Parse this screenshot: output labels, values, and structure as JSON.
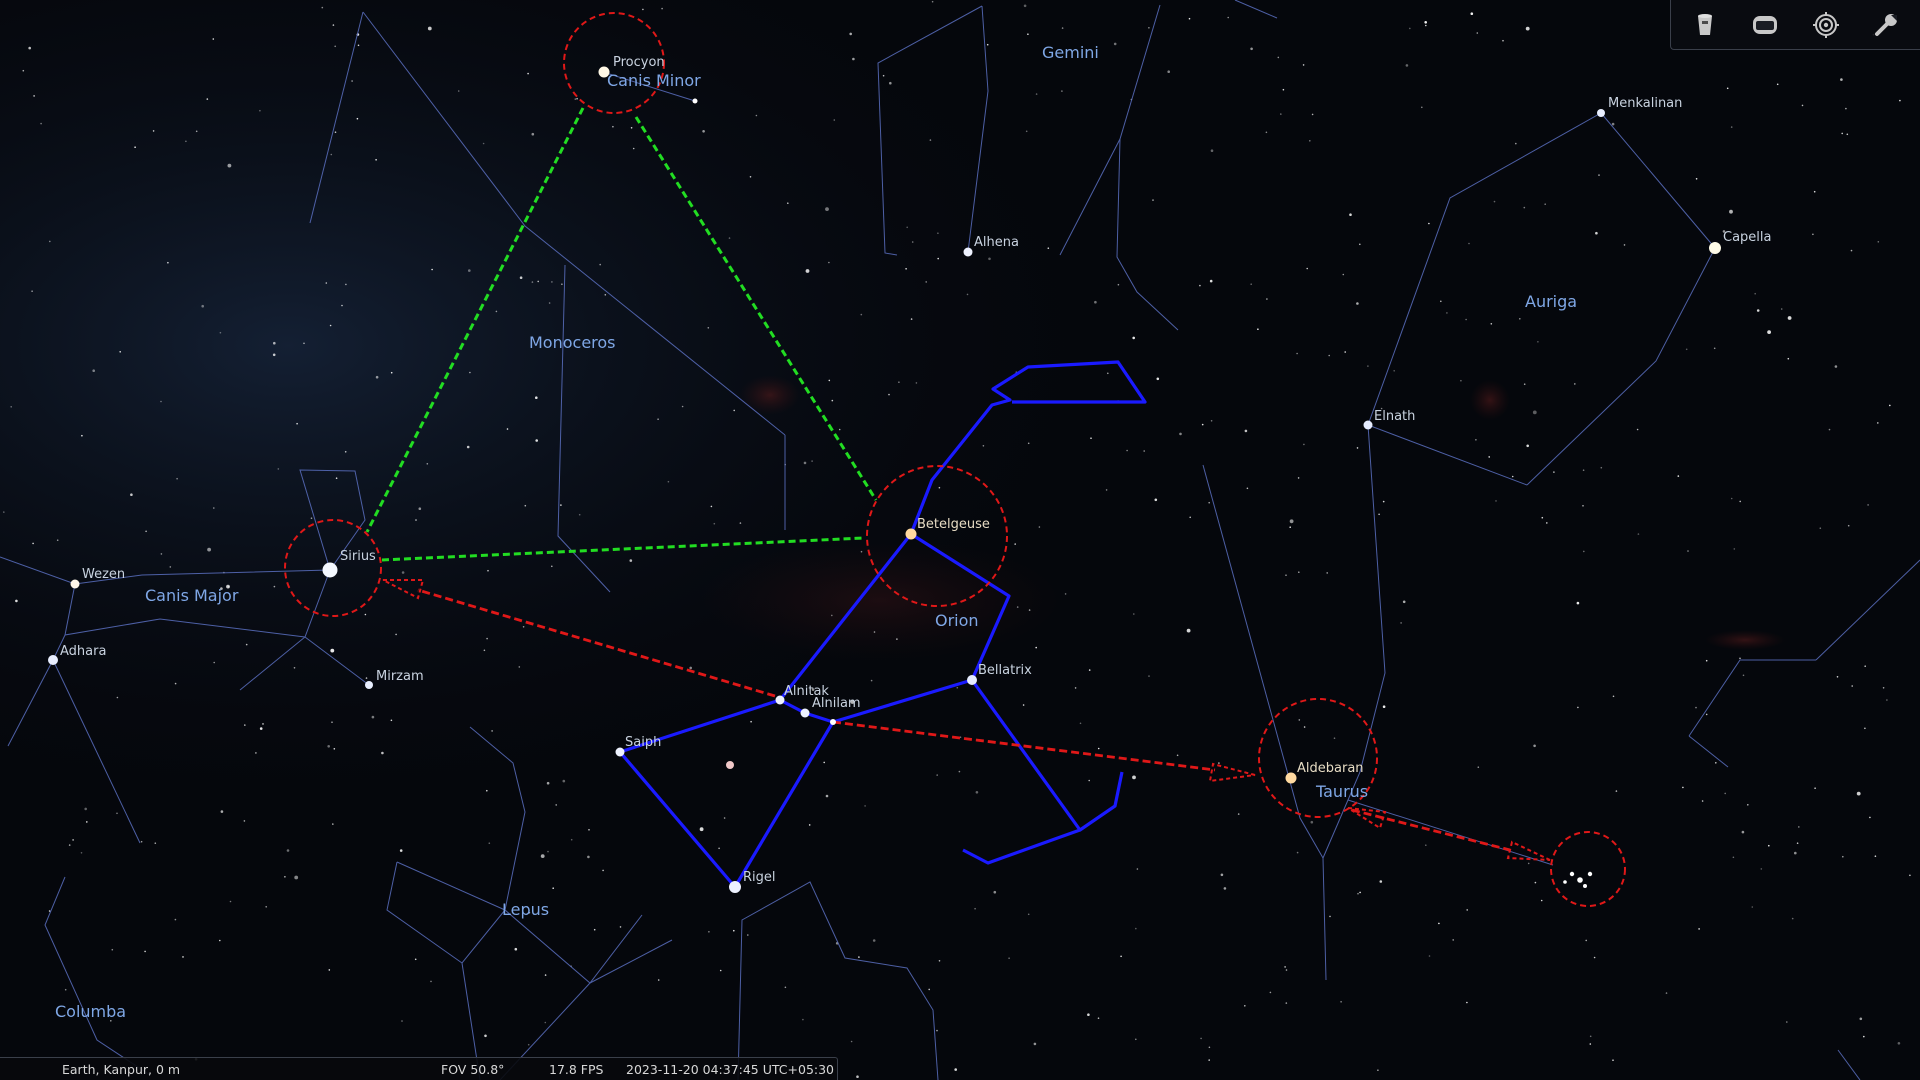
{
  "toolbar": {
    "buttons": [
      {
        "name": "bucket-icon",
        "title": "Sky"
      },
      {
        "name": "window-icon",
        "title": "View"
      },
      {
        "name": "target-icon",
        "title": "Center"
      },
      {
        "name": "wrench-icon",
        "title": "Configuration"
      }
    ],
    "icon_color": "#c8c8c8"
  },
  "status": {
    "location": "Earth, Kanpur, 0 m",
    "fov": "FOV 50.8°",
    "fps": "17.8 FPS",
    "datetime": "2023-11-20 04:37:45 UTC+05:30"
  },
  "constellations": {
    "gemini": "Gemini",
    "canis_minor": "Canis Minor",
    "monoceros": "Monoceros",
    "canis_major": "Canis Major",
    "orion": "Orion",
    "auriga": "Auriga",
    "taurus": "Taurus",
    "lepus": "Lepus",
    "columba": "Columba"
  },
  "stars": {
    "procyon": "Procyon",
    "menkalinan": "Menkalinan",
    "capella": "Capella",
    "alhena": "Alhena",
    "elnath": "Elnath",
    "betelgeuse": "Betelgeuse",
    "sirius": "Sirius",
    "wezen": "Wezen",
    "adhara": "Adhara",
    "mirzam": "Mirzam",
    "bellatrix": "Bellatrix",
    "alnitak": "Alnitak",
    "alnilam": "Alnilam",
    "saiph": "Saiph",
    "rigel": "Rigel",
    "aldebaran": "Aldebaran"
  },
  "colors": {
    "constellation_line": "#5a6fc0",
    "orion_highlight": "#1a1aff",
    "triangle": "#22dd22",
    "arrow": "#e01818",
    "circle": "#e01818",
    "label_blue": "#7fa7e6"
  }
}
